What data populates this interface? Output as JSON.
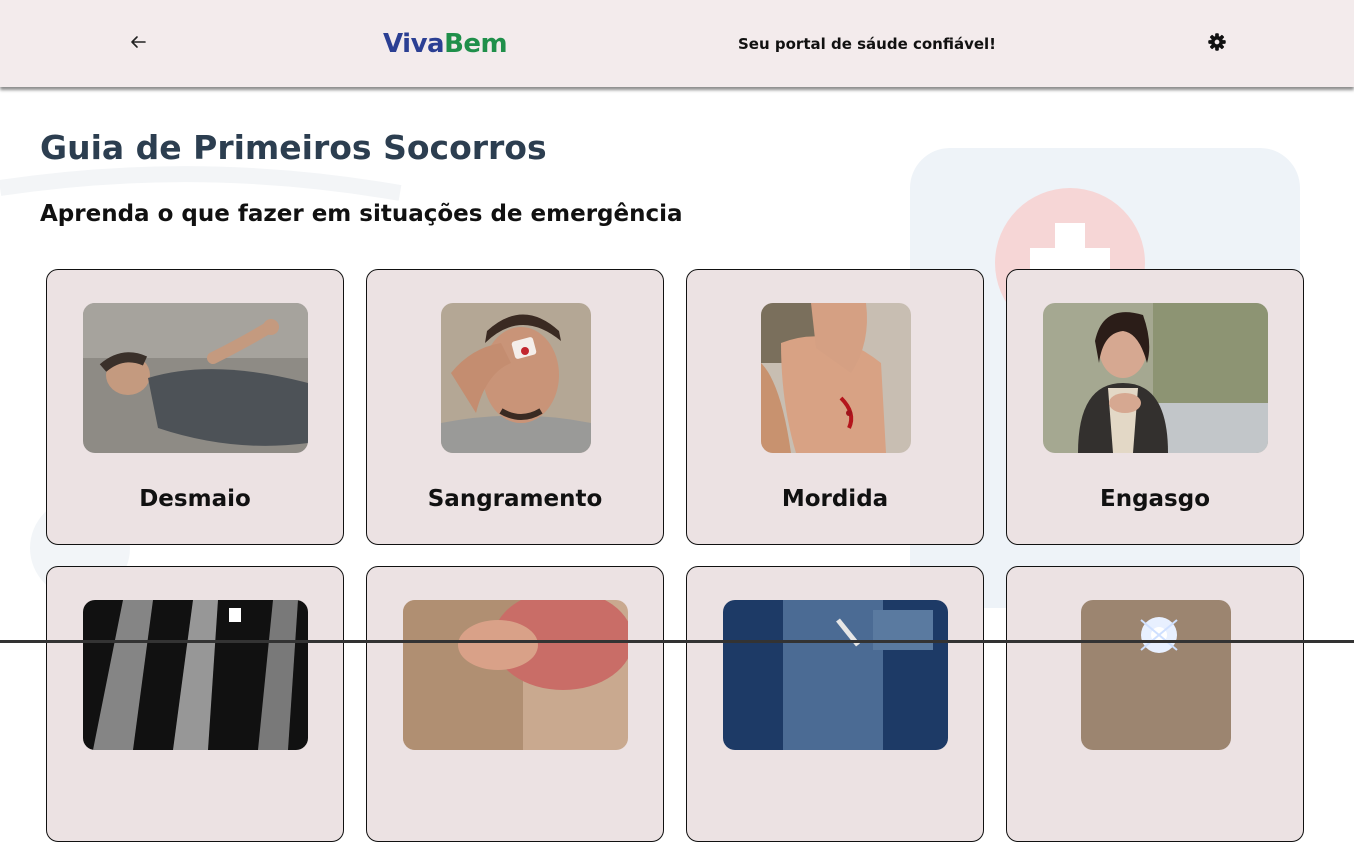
{
  "header": {
    "back_icon": "arrow-left-icon",
    "brand_part1": "Viva",
    "brand_part2": "Bem",
    "tagline": "Seu portal de sáude confiável!",
    "settings_icon": "gear-icon"
  },
  "colors": {
    "header_bg": "#f3ebec",
    "brand_blue": "#2b3f93",
    "brand_green": "#1f8f4a",
    "title": "#2c3e50",
    "card_bg": "#ece2e3"
  },
  "main": {
    "title": "Guia de Primeiros Socorros",
    "subtitle": "Aprenda o que fazer em situações de emergência",
    "cards": [
      {
        "label": "Desmaio",
        "image": "man-fainted-on-floor-photo"
      },
      {
        "label": "Sangramento",
        "image": "man-with-bleeding-eyebrow-photo"
      },
      {
        "label": "Mordida",
        "image": "bitten-knee-wound-photo"
      },
      {
        "label": "Engasgo",
        "image": "woman-choking-photo"
      },
      {
        "label": "",
        "image": "hand-xray-photo"
      },
      {
        "label": "",
        "image": "skin-burn-photo"
      },
      {
        "label": "",
        "image": "injection-photo"
      },
      {
        "label": "",
        "image": "electric-shock-photo"
      }
    ]
  }
}
